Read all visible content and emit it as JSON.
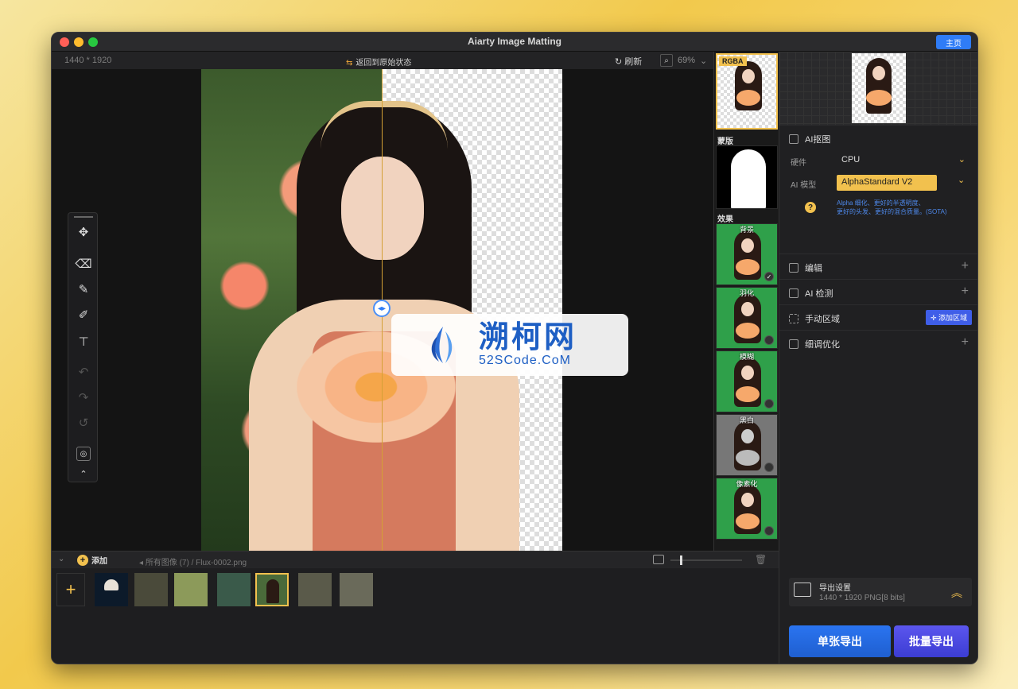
{
  "window": {
    "title": "Aiarty Image Matting",
    "home_label": "主页"
  },
  "toolbar": {
    "dimensions": "1440 * 1920",
    "reset_label": "返回到原始状态",
    "refresh_label": "刷新",
    "zoom": "69%"
  },
  "watermark": {
    "cn": "溯柯网",
    "en": "52SCode.CoM"
  },
  "strip": {
    "rgba_label": "RGBA",
    "mask_label": "蒙版",
    "effects_label": "效果",
    "effects": [
      {
        "label": "背景",
        "bg": "green"
      },
      {
        "label": "羽化",
        "bg": "green"
      },
      {
        "label": "模糊",
        "bg": "green"
      },
      {
        "label": "黑白",
        "bg": "gray"
      },
      {
        "label": "像素化",
        "bg": "green"
      }
    ]
  },
  "right_panel": {
    "ai_matting": {
      "title": "AI抠图",
      "hardware_label": "硬件",
      "hardware_value": "CPU",
      "model_label": "AI 模型",
      "model_value": "AlphaStandard  V2",
      "model_desc_1": "Alpha 细化、更好的半透明度、",
      "model_desc_2": "更好的头发、更好的混合质量。(SOTA)"
    },
    "sections": [
      {
        "label": "编辑"
      },
      {
        "label": "AI 检测"
      },
      {
        "label": "手动区域",
        "action": "添加区域"
      },
      {
        "label": "细调优化"
      }
    ],
    "export": {
      "title": "导出设置",
      "subtitle": "1440 * 1920 PNG[8 bits]",
      "single_label": "单张导出",
      "batch_label": "批量导出"
    }
  },
  "bottom_bar": {
    "add_label": "添加",
    "path": "所有图像 (7)  /  Flux-0002.png"
  },
  "colors": {
    "accent": "#f2c14e",
    "primary": "#2f7cf6",
    "batch": "#4b4be0"
  }
}
